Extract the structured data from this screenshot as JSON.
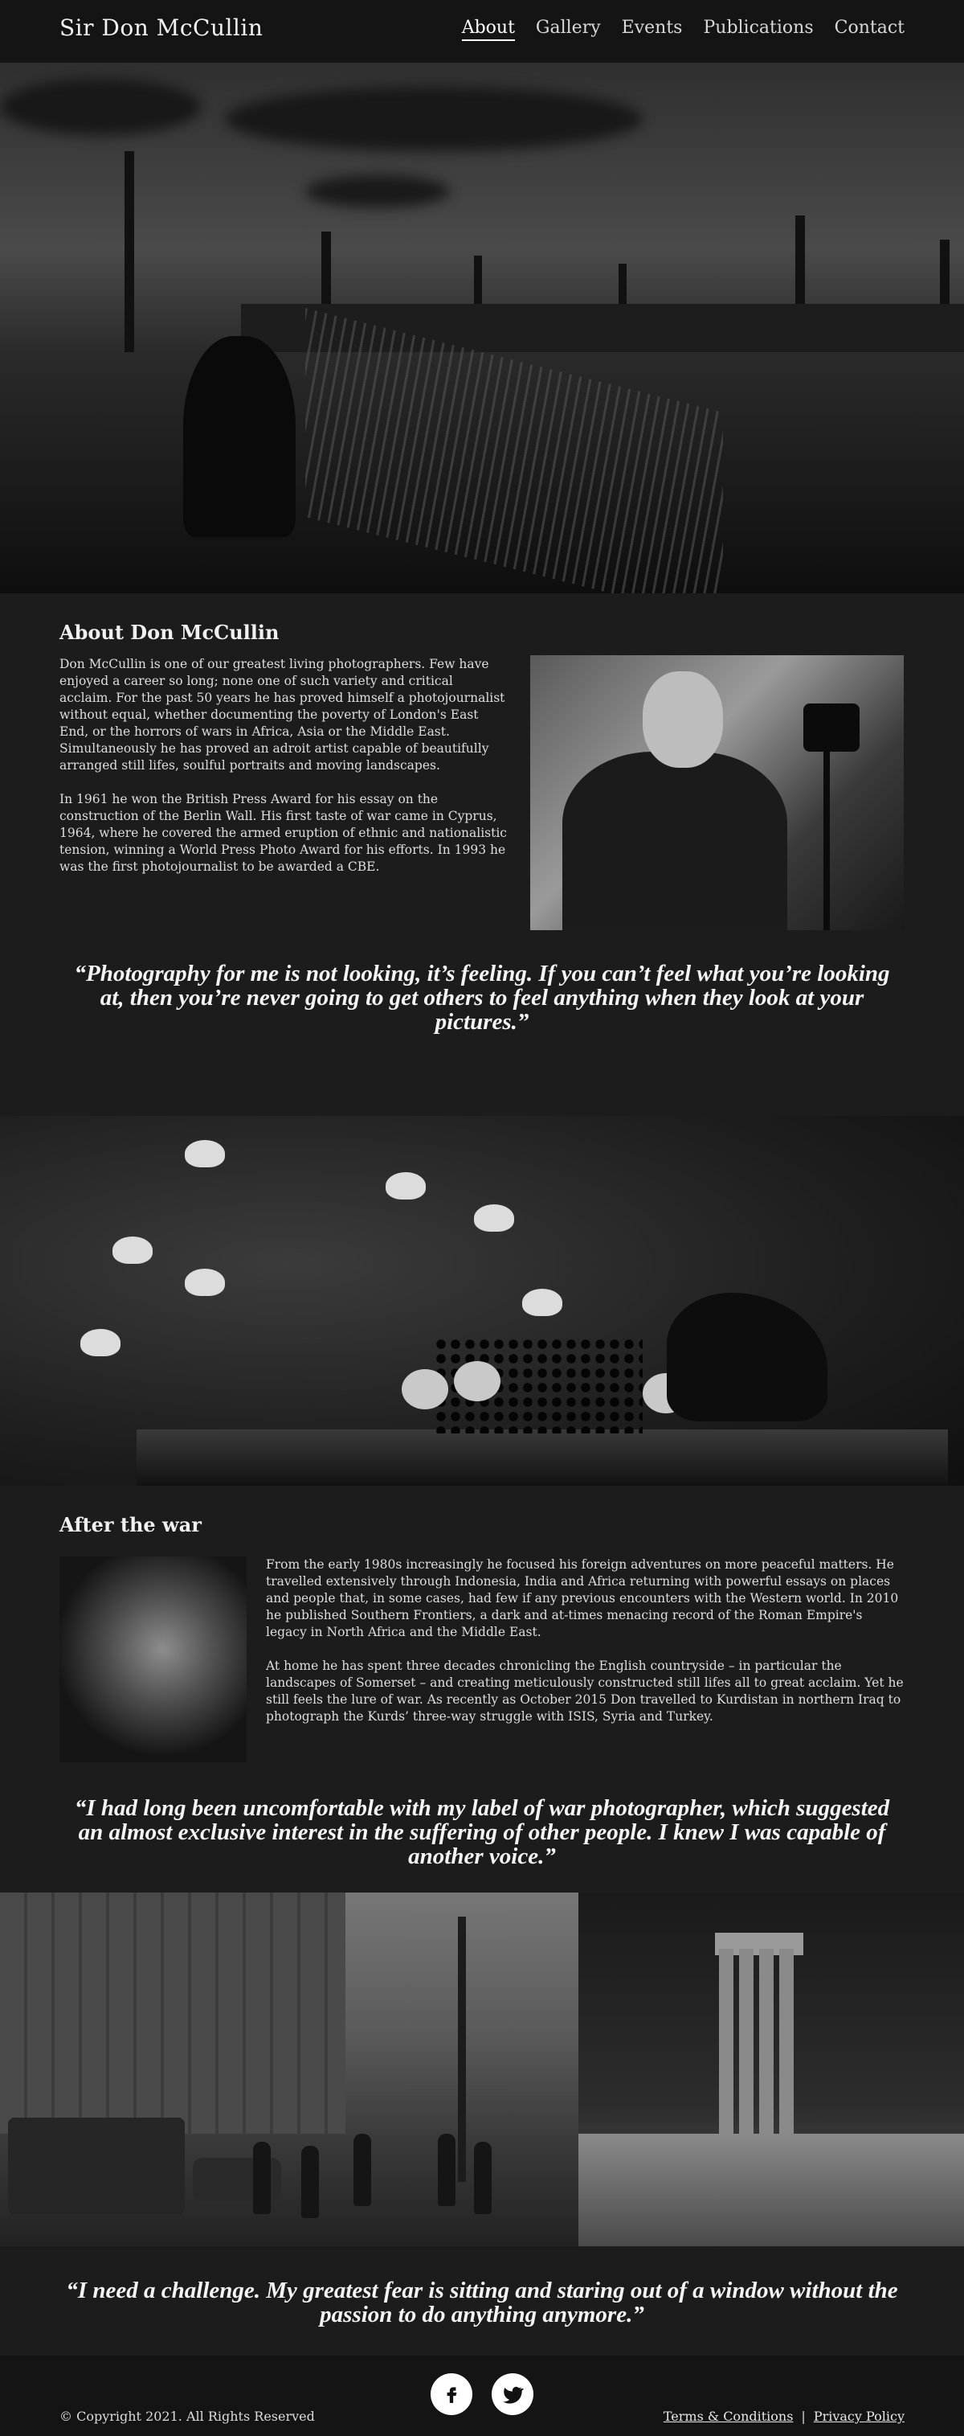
{
  "header": {
    "brand": "Sir Don McCullin",
    "nav": [
      "About",
      "Gallery",
      "Events",
      "Publications",
      "Contact"
    ],
    "active": "About"
  },
  "about": {
    "title": "About Don McCullin",
    "p1": "Don McCullin is one of our greatest living photographers. Few have enjoyed a career so long; none one of such variety and critical acclaim. For the past 50 years he has proved himself a photojournalist without equal, whether documenting the poverty of London's East End, or the horrors of wars in Africa, Asia or the Middle East. Simultaneously he has proved an adroit artist capable of beautifully arranged still lifes, soulful portraits and moving landscapes.",
    "p2": "In 1961 he won the British Press Award for his essay on the construction of the Berlin Wall. His first taste of war came in Cyprus, 1964, where he covered the armed eruption of ethnic and nationalistic tension, winning a World Press Photo Award for his efforts. In 1993 he was the first photojournalist to be awarded a CBE.",
    "quote": "“Photography for me is not looking, it’s feeling. If you can’t feel what you’re looking at, then you’re never going to get others to feel anything when they look at your pictures.”"
  },
  "after_war": {
    "title": "After the war",
    "p1": "From the early 1980s increasingly he focused his foreign adventures on more peaceful matters. He travelled extensively through Indonesia, India and Africa returning with powerful essays on places and people that, in some cases, had few if any previous encounters with the Western world. In 2010 he published Southern Frontiers, a dark and at-times menacing record of the Roman Empire's legacy in North Africa and the Middle East.",
    "p2": "At home he has spent three decades chronicling the English countryside – in particular the landscapes of Somerset – and creating meticulously constructed still lifes all to great acclaim. Yet he still feels the lure of war. As recently as October 2015 Don travelled to Kurdistan in northern Iraq to photograph the Kurds’ three-way struggle with ISIS, Syria and Turkey.",
    "quote": "“I had long been uncomfortable with my label of war photographer, which suggested an almost exclusive interest in the suffering of other people. I knew I was capable of another voice.”"
  },
  "closing": {
    "quote": "“I need a challenge. My greatest fear is sitting and staring out of a window without the passion to do anything anymore.”"
  },
  "footer": {
    "copyright": "© Copyright 2021. All Rights Reserved",
    "terms": "Terms & Conditions",
    "separator": "|",
    "privacy": "Privacy Policy",
    "social_icons": [
      "facebook-icon",
      "twitter-icon"
    ]
  }
}
